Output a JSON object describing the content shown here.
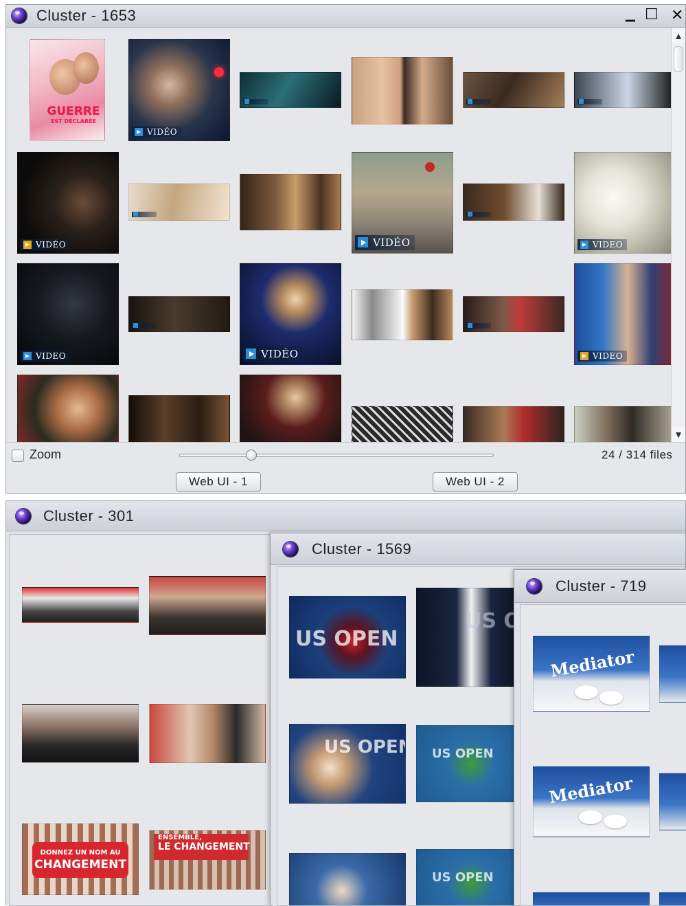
{
  "windows": {
    "top": {
      "title": "Cluster - 1653"
    },
    "left": {
      "title": "Cluster - 301"
    },
    "middle": {
      "title": "Cluster - 1569"
    },
    "right": {
      "title": "Cluster - 719"
    }
  },
  "window_controls": {
    "minimize": "▁",
    "maximize": "☐",
    "close": "✕"
  },
  "badges": {
    "video": "VIDÉO",
    "video_alt": "VIDEO"
  },
  "poster": {
    "line1": "GUERRE",
    "line2": "EST DÉCLARÉE"
  },
  "zoom": {
    "label": "Zoom",
    "checked": false,
    "level": 0.22
  },
  "file_count": "24 / 314 files",
  "buttons": {
    "web_ui_1": "Web UI - 1",
    "web_ui_2": "Web UI - 2"
  },
  "scroll": {
    "up": "▲",
    "down": "▼"
  },
  "campaign": {
    "line1": "DONNEZ UN NOM AU",
    "line2": "CHANGEMENT",
    "slogan1": "ENSEMBLE,",
    "slogan2": "LE CHANGEMENT"
  },
  "usopen": {
    "text": "US OPEN",
    "short": "US OPEN"
  },
  "mediator": {
    "brand": "Mediator"
  },
  "colors": {
    "window_bg": "#e5e7ea",
    "titlebar": "#d5d8dd",
    "video_badge_blue": "#2c8fd6",
    "video_badge_orange": "#e8a317",
    "campaign_red": "#d8252f",
    "usopen_blue": "#1a3f7a"
  }
}
